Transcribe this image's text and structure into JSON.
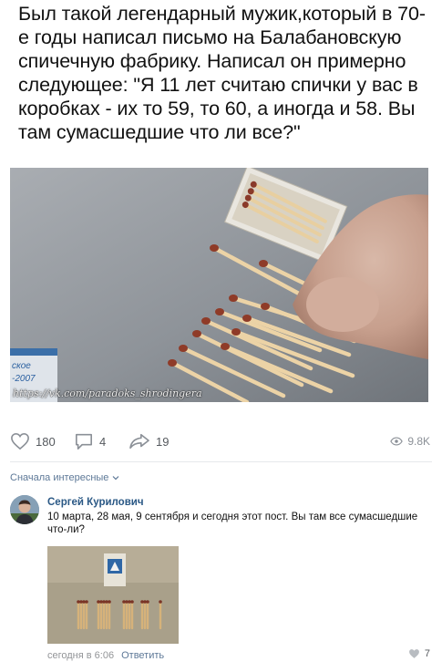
{
  "post": {
    "text": "Был такой легендарный мужик,который в 70-е годы написал письмо на Балабановскую спичечную фабрику. Написал он примерно следующее: \"Я 11 лет считаю спички у вас в коробках - их то 59, то 60, а иногда и 58. Вы там сумасшедшие что ли все?\"",
    "photo": {
      "watermark": "https://vk.com/paradoks_shrodingera",
      "box_label": "ское\n-2007"
    },
    "actions": {
      "likes": "180",
      "comments": "4",
      "shares": "19",
      "views": "9.8K"
    }
  },
  "comments_sort": {
    "label": "Сначала интересные"
  },
  "comment": {
    "author": "Сергей Курилович",
    "text": "10 марта, 28 мая, 9 сентября и сегодня этот пост. Вы там все сумасшедшие что-ли?",
    "time": "сегодня в 6:06",
    "reply_label": "Ответить",
    "likes": "7"
  },
  "colors": {
    "link": "#2a5885",
    "meta": "#939598",
    "icon": "#8b9097"
  },
  "icons": {
    "like": "heart-icon",
    "comment": "comment-bubble-icon",
    "share": "share-arrow-icon",
    "views": "eye-icon",
    "sort": "chevron-down-icon"
  }
}
